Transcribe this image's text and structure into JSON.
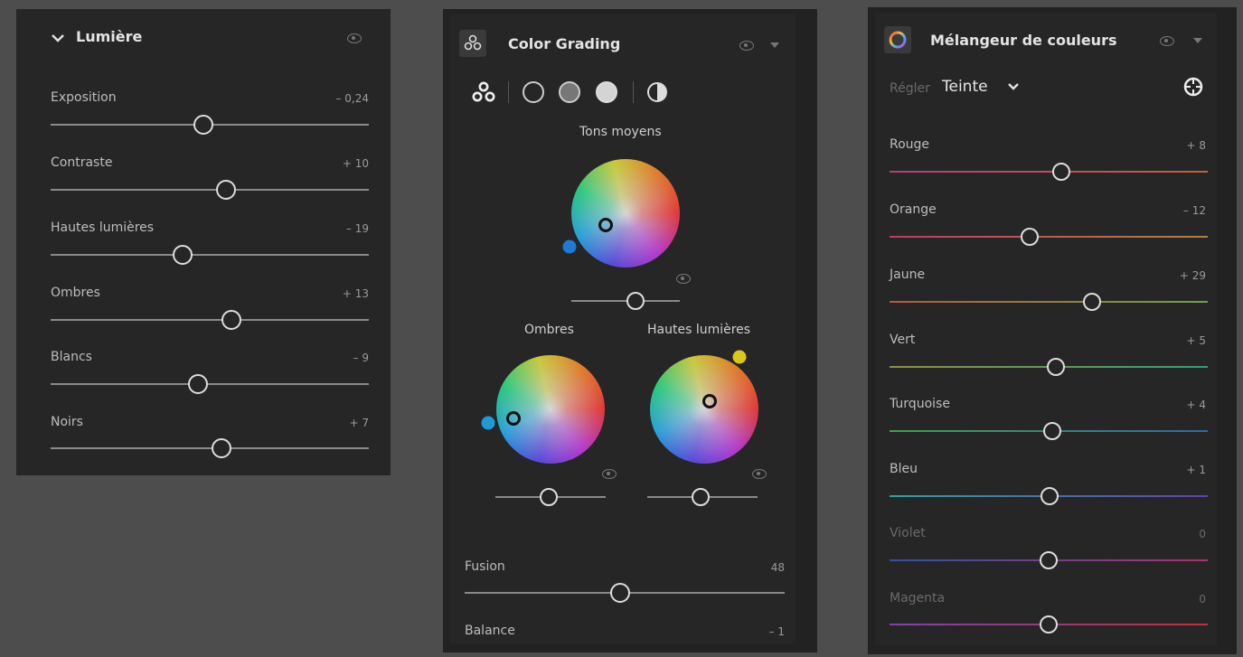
{
  "light_panel": {
    "title": "Lumière",
    "sliders": [
      {
        "label": "Exposition",
        "value": "– 0,24"
      },
      {
        "label": "Contraste",
        "value": "+ 10"
      },
      {
        "label": "Hautes lumières",
        "value": "– 19"
      },
      {
        "label": "Ombres",
        "value": "+ 13"
      },
      {
        "label": "Blancs",
        "value": "– 9"
      },
      {
        "label": "Noirs",
        "value": "+ 7"
      }
    ]
  },
  "grading_panel": {
    "title": "Color Grading",
    "midtones_label": "Tons moyens",
    "shadows_label": "Ombres",
    "highlights_label": "Hautes lumières",
    "blending_label": "Fusion",
    "blending_value": "48",
    "balance_label": "Balance",
    "balance_value": "– 1",
    "colors": {
      "shadows_dot": "#1e9ad6",
      "midtones_dot": "#1e7ad6",
      "highlights_dot": "#d9c81a"
    }
  },
  "mixer_panel": {
    "title": "Mélangeur de couleurs",
    "adjust_label": "Régler",
    "adjust_value": "Teinte",
    "sliders": [
      {
        "label": "Rouge",
        "value": "+ 8"
      },
      {
        "label": "Orange",
        "value": "– 12"
      },
      {
        "label": "Jaune",
        "value": "+ 29"
      },
      {
        "label": "Vert",
        "value": "+ 5"
      },
      {
        "label": "Turquoise",
        "value": "+ 4"
      },
      {
        "label": "Bleu",
        "value": "+ 1"
      },
      {
        "label": "Violet",
        "value": "0"
      },
      {
        "label": "Magenta",
        "value": "0"
      }
    ]
  }
}
